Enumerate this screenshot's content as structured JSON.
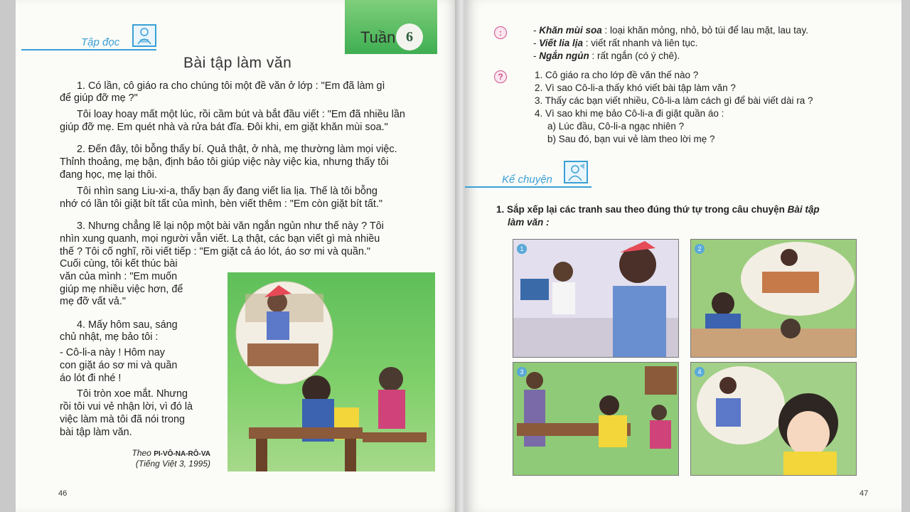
{
  "left_page": {
    "section_label": "Tập đọc",
    "week_label": "Tuần",
    "week_number": "6",
    "title": "Bài tập làm văn",
    "paragraphs": [
      "1. Có lần, cô giáo ra cho chúng tôi một đề văn ở lớp : \"Em đã làm gì",
      "để giúp đỡ mẹ ?\"",
      "Tôi loay hoay mất một lúc, rồi cầm bút và bắt đầu viết : \"Em đã nhiều lần",
      "giúp đỡ mẹ. Em quét nhà và rửa bát đĩa. Đôi khi, em giặt khăn mùi soa.\"",
      "2. Đến đây, tôi bỗng thấy bí. Quả thật, ở nhà, mẹ thường làm mọi việc.",
      "Thỉnh thoảng, mẹ bận, định bảo tôi giúp việc này việc kia, nhưng thấy tôi",
      "đang học, mẹ lại thôi.",
      "Tôi nhìn sang Liu-xi-a, thấy bạn ấy đang viết lia lịa. Thế là tôi bỗng",
      "nhớ có lần tôi giặt bít tất của mình, bèn viết thêm : \"Em còn giặt bít tất.\"",
      "3. Nhưng chẳng lẽ lại nộp một bài văn ngắn ngủn như thế này ? Tôi",
      "nhìn xung quanh, mọi người vẫn viết. Lạ thật, các bạn viết gì mà nhiều",
      "thế ? Tôi cố nghĩ, rồi viết tiếp : \"Em giặt cả áo lót, áo sơ mi và quần.\"",
      "Cuối cùng, tôi kết thúc bài",
      "văn của mình : \"Em muốn",
      "giúp mẹ nhiều việc hơn, để",
      "mẹ đỡ vất vả.\"",
      "4. Mấy hôm sau, sáng",
      "chủ nhật, mẹ bảo tôi :",
      "- Cô-li-a này ! Hôm nay",
      "con giặt áo sơ mi và quần",
      "áo lót đi nhé !",
      "Tôi tròn xoe mắt. Nhưng",
      "rồi tôi vui vẻ nhận lời, vì đó là",
      "việc làm mà tôi đã nói trong",
      "bài tập làm văn."
    ],
    "credit_prefix": "Theo",
    "credit_author": "PI-VÔ-NA-RÔ-VA",
    "credit_source": "(Tiếng Việt 3, 1995)",
    "page_number": "46"
  },
  "right_page": {
    "glossary": [
      {
        "term": "Khăn mùi soa",
        "definition": " : loại khăn mỏng, nhỏ, bỏ túi để lau mặt, lau tay."
      },
      {
        "term": "Viết lia lịa",
        "definition": " : viết rất nhanh và liên tục."
      },
      {
        "term": "Ngắn ngủn",
        "definition": " : rất ngắn (có ý chê)."
      }
    ],
    "glossary_icon": ":",
    "question_icon": "?",
    "questions": [
      "1. Cô giáo ra cho lớp đề văn thế nào ?",
      "2. Vì sao Cô-li-a thấy khó viết bài tập làm văn ?",
      "3. Thấy các bạn viết nhiều, Cô-li-a làm cách gì để bài viết dài ra ?",
      "4. Vì sao khi mẹ bảo Cô-li-a đi giặt quần áo :",
      "a) Lúc đầu, Cô-li-a ngạc nhiên ?",
      "b) Sau đó, bạn vui vẻ làm theo lời mẹ ?"
    ],
    "section_label": "Kể chuyện",
    "task_line1_normal": "1. Sắp xếp lại các tranh sau theo đúng thứ tự trong câu chuyện ",
    "task_line1_italic": "Bài tập",
    "task_line2": "làm văn :",
    "picture_numbers": [
      "1",
      "2",
      "3",
      "4"
    ],
    "page_number": "47"
  },
  "colors": {
    "accent_blue": "#3aa0d6",
    "week_green": "#3fae52",
    "icon_pink": "#d0528a"
  }
}
